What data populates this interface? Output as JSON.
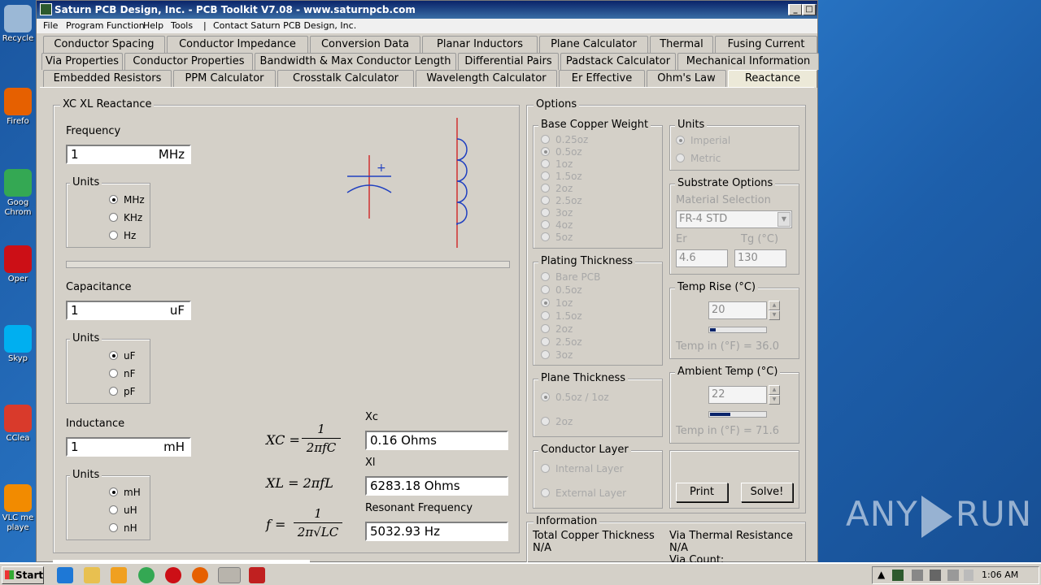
{
  "desktop": {
    "icons": [
      {
        "label": "Recycle",
        "color": "#9bb8d6"
      },
      {
        "label": "Firefo",
        "color": "#e66000"
      },
      {
        "label": "Goog Chrom",
        "color": "#34a853"
      },
      {
        "label": "Oper",
        "color": "#cc0f16"
      },
      {
        "label": "Skyp",
        "color": "#00aff0"
      },
      {
        "label": "CClea",
        "color": "#d93a2b"
      },
      {
        "label": "VLC me playe",
        "color": "#f28b00"
      }
    ],
    "watermark": "ANY RUN"
  },
  "window": {
    "title": "Saturn PCB Design, Inc. - PCB Toolkit V7.08 - www.saturnpcb.com",
    "menu": [
      "File",
      "Program Function",
      "Help",
      "Tools",
      "|",
      "Contact Saturn PCB Design, Inc."
    ],
    "tabs_row1": [
      "Conductor Spacing",
      "Conductor Impedance",
      "Conversion Data",
      "Planar Inductors",
      "Plane Calculator",
      "Thermal",
      "Fusing Current"
    ],
    "tabs_row2": [
      "Via Properties",
      "Conductor Properties",
      "Bandwidth & Max Conductor Length",
      "Differential Pairs",
      "Padstack Calculator",
      "Mechanical Information"
    ],
    "tabs_row3": [
      "Embedded Resistors",
      "PPM Calculator",
      "Crosstalk Calculator",
      "Wavelength Calculator",
      "Er Effective",
      "Ohm's Law",
      "Reactance"
    ],
    "active_tab": "Reactance"
  },
  "reactance": {
    "group_title": "XC XL Reactance",
    "frequency": {
      "label": "Frequency",
      "value": "1",
      "unit": "MHz",
      "units_title": "Units",
      "options": [
        "MHz",
        "KHz",
        "Hz"
      ],
      "selected": "MHz"
    },
    "capacitance": {
      "label": "Capacitance",
      "value": "1",
      "unit": "uF",
      "units_title": "Units",
      "options": [
        "uF",
        "nF",
        "pF"
      ],
      "selected": "uF"
    },
    "inductance": {
      "label": "Inductance",
      "value": "1",
      "unit": "mH",
      "units_title": "Units",
      "options": [
        "mH",
        "uH",
        "nH"
      ],
      "selected": "mH"
    },
    "cap_symbol_plus": "+",
    "formulas": {
      "xc_lhs": "XC =",
      "xc_num": "1",
      "xc_den": "2πfC",
      "xl": "XL = 2πfL",
      "f_lhs": "f =",
      "f_num": "1",
      "f_den": "2π√LC"
    },
    "results": {
      "xc_label": "Xc",
      "xc_value": "0.16 Ohms",
      "xl_label": "Xl",
      "xl_value": "6283.18 Ohms",
      "rf_label": "Resonant Frequency",
      "rf_value": "5032.93 Hz"
    }
  },
  "options": {
    "title": "Options",
    "base_copper": {
      "title": "Base Copper Weight",
      "options": [
        "0.25oz",
        "0.5oz",
        "1oz",
        "1.5oz",
        "2oz",
        "2.5oz",
        "3oz",
        "4oz",
        "5oz"
      ],
      "selected": "0.5oz"
    },
    "plating": {
      "title": "Plating Thickness",
      "options": [
        "Bare PCB",
        "0.5oz",
        "1oz",
        "1.5oz",
        "2oz",
        "2.5oz",
        "3oz"
      ],
      "selected": "1oz"
    },
    "plane": {
      "title": "Plane Thickness",
      "options": [
        "0.5oz / 1oz",
        "2oz"
      ],
      "selected": "0.5oz / 1oz"
    },
    "conductor_layer": {
      "title": "Conductor Layer",
      "options": [
        "Internal Layer",
        "External Layer"
      ]
    },
    "units": {
      "title": "Units",
      "options": [
        "Imperial",
        "Metric"
      ],
      "selected": "Imperial"
    },
    "substrate": {
      "title": "Substrate Options",
      "material_label": "Material Selection",
      "material": "FR-4 STD",
      "er_label": "Er",
      "er": "4.6",
      "tg_label": "Tg (°C)",
      "tg": "130"
    },
    "temp_rise": {
      "title": "Temp Rise (°C)",
      "value": "20",
      "readout": "Temp in (°F) = 36.0",
      "level": 0.1
    },
    "ambient": {
      "title": "Ambient Temp (°C)",
      "value": "22",
      "readout": "Temp in (°F) = 71.6",
      "level": 0.35
    },
    "print_label": "Print",
    "solve_label": "Solve!"
  },
  "information": {
    "title": "Information",
    "total_copper_label": "Total Copper Thickness",
    "total_copper_value": "N/A",
    "via_thermal_label": "Via Thermal Resistance",
    "via_thermal_value": "N/A",
    "via_count_label": "Via Count:"
  },
  "taskbar": {
    "start": "Start",
    "time": "1:06 AM"
  }
}
